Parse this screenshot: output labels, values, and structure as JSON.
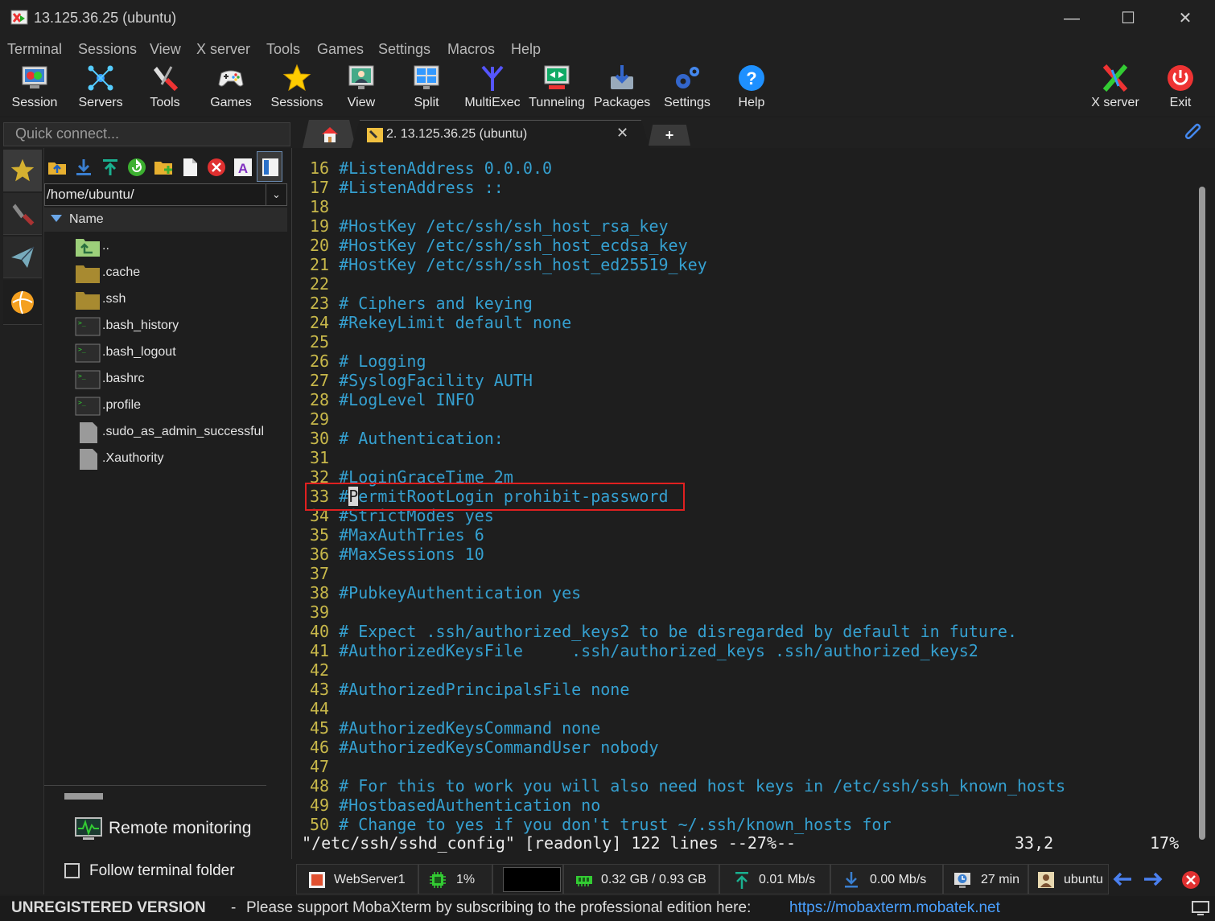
{
  "window": {
    "title": "13.125.36.25 (ubuntu)",
    "minimize": "—",
    "maximize": "☐",
    "close": "✕"
  },
  "menu": [
    "Terminal",
    "Sessions",
    "View",
    "X server",
    "Tools",
    "Games",
    "Settings",
    "Macros",
    "Help"
  ],
  "toolbar": {
    "session": "Session",
    "servers": "Servers",
    "tools": "Tools",
    "games": "Games",
    "sessions": "Sessions",
    "view": "View",
    "split": "Split",
    "multiexec": "MultiExec",
    "tunneling": "Tunneling",
    "packages": "Packages",
    "settings": "Settings",
    "help": "Help",
    "xserver": "X server",
    "exit": "Exit"
  },
  "quick_connect": {
    "placeholder": "Quick connect..."
  },
  "tabs": {
    "active_label": "2. 13.125.36.25 (ubuntu)",
    "close": "✕",
    "new": "+"
  },
  "sftp": {
    "path": "/home/ubuntu/",
    "column": "Name",
    "files": [
      {
        "name": "..",
        "type": "up"
      },
      {
        "name": ".cache",
        "type": "folder"
      },
      {
        "name": ".ssh",
        "type": "folder"
      },
      {
        "name": ".bash_history",
        "type": "script"
      },
      {
        "name": ".bash_logout",
        "type": "script"
      },
      {
        "name": ".bashrc",
        "type": "script"
      },
      {
        "name": ".profile",
        "type": "script"
      },
      {
        "name": ".sudo_as_admin_successful",
        "type": "file"
      },
      {
        "name": ".Xauthority",
        "type": "file"
      }
    ],
    "remote_monitoring": "Remote monitoring",
    "follow_folder": "Follow terminal folder"
  },
  "terminal": {
    "lines": [
      {
        "n": "16",
        "t": "#ListenAddress 0.0.0.0"
      },
      {
        "n": "17",
        "t": "#ListenAddress ::"
      },
      {
        "n": "18",
        "t": ""
      },
      {
        "n": "19",
        "t": "#HostKey /etc/ssh/ssh_host_rsa_key"
      },
      {
        "n": "20",
        "t": "#HostKey /etc/ssh/ssh_host_ecdsa_key"
      },
      {
        "n": "21",
        "t": "#HostKey /etc/ssh/ssh_host_ed25519_key"
      },
      {
        "n": "22",
        "t": ""
      },
      {
        "n": "23",
        "t": "# Ciphers and keying"
      },
      {
        "n": "24",
        "t": "#RekeyLimit default none"
      },
      {
        "n": "25",
        "t": ""
      },
      {
        "n": "26",
        "t": "# Logging"
      },
      {
        "n": "27",
        "t": "#SyslogFacility AUTH"
      },
      {
        "n": "28",
        "t": "#LogLevel INFO"
      },
      {
        "n": "29",
        "t": ""
      },
      {
        "n": "30",
        "t": "# Authentication:"
      },
      {
        "n": "31",
        "t": ""
      },
      {
        "n": "32",
        "t": "#LoginGraceTime 2m"
      },
      {
        "n": "33",
        "t": "#PermitRootLogin prohibit-password"
      },
      {
        "n": "34",
        "t": "#StrictModes yes"
      },
      {
        "n": "35",
        "t": "#MaxAuthTries 6"
      },
      {
        "n": "36",
        "t": "#MaxSessions 10"
      },
      {
        "n": "37",
        "t": ""
      },
      {
        "n": "38",
        "t": "#PubkeyAuthentication yes"
      },
      {
        "n": "39",
        "t": ""
      },
      {
        "n": "40",
        "t": "# Expect .ssh/authorized_keys2 to be disregarded by default in future."
      },
      {
        "n": "41",
        "t": "#AuthorizedKeysFile     .ssh/authorized_keys .ssh/authorized_keys2"
      },
      {
        "n": "42",
        "t": ""
      },
      {
        "n": "43",
        "t": "#AuthorizedPrincipalsFile none"
      },
      {
        "n": "44",
        "t": ""
      },
      {
        "n": "45",
        "t": "#AuthorizedKeysCommand none"
      },
      {
        "n": "46",
        "t": "#AuthorizedKeysCommandUser nobody"
      },
      {
        "n": "47",
        "t": ""
      },
      {
        "n": "48",
        "t": "# For this to work you will also need host keys in /etc/ssh/ssh_known_hosts"
      },
      {
        "n": "49",
        "t": "#HostbasedAuthentication no"
      },
      {
        "n": "50",
        "t": "# Change to yes if you don't trust ~/.ssh/known_hosts for"
      }
    ],
    "status": "\"/etc/ssh/sshd_config\" [readonly] 122 lines --27%--",
    "position": "33,2",
    "percent": "17%",
    "highlight_line": "33"
  },
  "statusbar": {
    "server": "WebServer1",
    "cpu": "1%",
    "memory": "0.32 GB / 0.93 GB",
    "upload": "0.01 Mb/s",
    "download": "0.00 Mb/s",
    "uptime": "27 min",
    "user": "ubuntu"
  },
  "footer": {
    "unregistered": "UNREGISTERED VERSION",
    "dash": "-",
    "message": "Please support MobaXterm by subscribing to the professional edition here:",
    "link": "https://mobaxterm.mobatek.net"
  },
  "colors": {
    "line_number": "#c8b84a",
    "comment_text": "#35a0d0",
    "highlight_box": "#e02020",
    "link": "#4aa0ff"
  }
}
